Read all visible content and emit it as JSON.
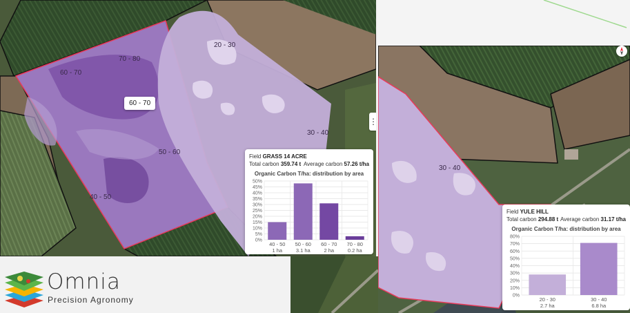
{
  "left_map": {
    "zone_labels": {
      "z1": "60 - 70",
      "z2": "70 - 80",
      "z3": "20 - 30",
      "z4": "30 - 40",
      "z5": "50 - 60",
      "z6": "40 - 50"
    },
    "tooltip": "60 - 70",
    "menu_icon": "⋮",
    "info": {
      "field_label": "Field",
      "field_name": "GRASS 14 ACRE",
      "total_label": "Total carbon",
      "total_value": "359.74 t",
      "avg_label": "Average carbon",
      "avg_value": "57.26 t/ha",
      "chart_title": "Organic Carbon T/ha: distribution by area"
    }
  },
  "right_map": {
    "zone_label": "30 - 40",
    "info": {
      "field_label": "Field",
      "field_name": "YULE HILL",
      "total_label": "Total carbon",
      "total_value": "294.88 t",
      "avg_label": "Average carbon",
      "avg_value": "31.17 t/ha",
      "chart_title": "Organic Carbon T/ha: distribution by area"
    }
  },
  "logo": {
    "name": "Omnia",
    "tagline": "Precision Agronomy"
  },
  "colors": {
    "zone_dark": "#7a4fa5",
    "zone_mid": "#9a78be",
    "zone_light": "#c3afd9",
    "field_border": "#e83a5a"
  },
  "chart_data": [
    {
      "type": "bar",
      "categories": [
        "40 - 50",
        "50 - 60",
        "60 - 70",
        "70 - 80"
      ],
      "sublabels": [
        "1 ha",
        "3.1 ha",
        "2 ha",
        "0.2 ha"
      ],
      "values": [
        15,
        48,
        31,
        3
      ],
      "colors": [
        "#8c68b6",
        "#8c68b6",
        "#7448a3",
        "#6a3d9a"
      ],
      "title": "Organic Carbon T/ha: distribution by area",
      "ylim": [
        0,
        50
      ],
      "yticks": [
        "0%",
        "5%",
        "10%",
        "15%",
        "20%",
        "25%",
        "30%",
        "35%",
        "40%",
        "45%",
        "50%"
      ],
      "grid": true
    },
    {
      "type": "bar",
      "categories": [
        "20 - 30",
        "30 - 40"
      ],
      "sublabels": [
        "2.7 ha",
        "6.8 ha"
      ],
      "values": [
        28,
        71
      ],
      "colors": [
        "#c3afd9",
        "#a98acb"
      ],
      "title": "Organic Carbon T/ha: distribution by area",
      "ylim": [
        0,
        80
      ],
      "yticks": [
        "0%",
        "10%",
        "20%",
        "30%",
        "40%",
        "50%",
        "60%",
        "70%",
        "80%"
      ],
      "grid": true
    }
  ]
}
